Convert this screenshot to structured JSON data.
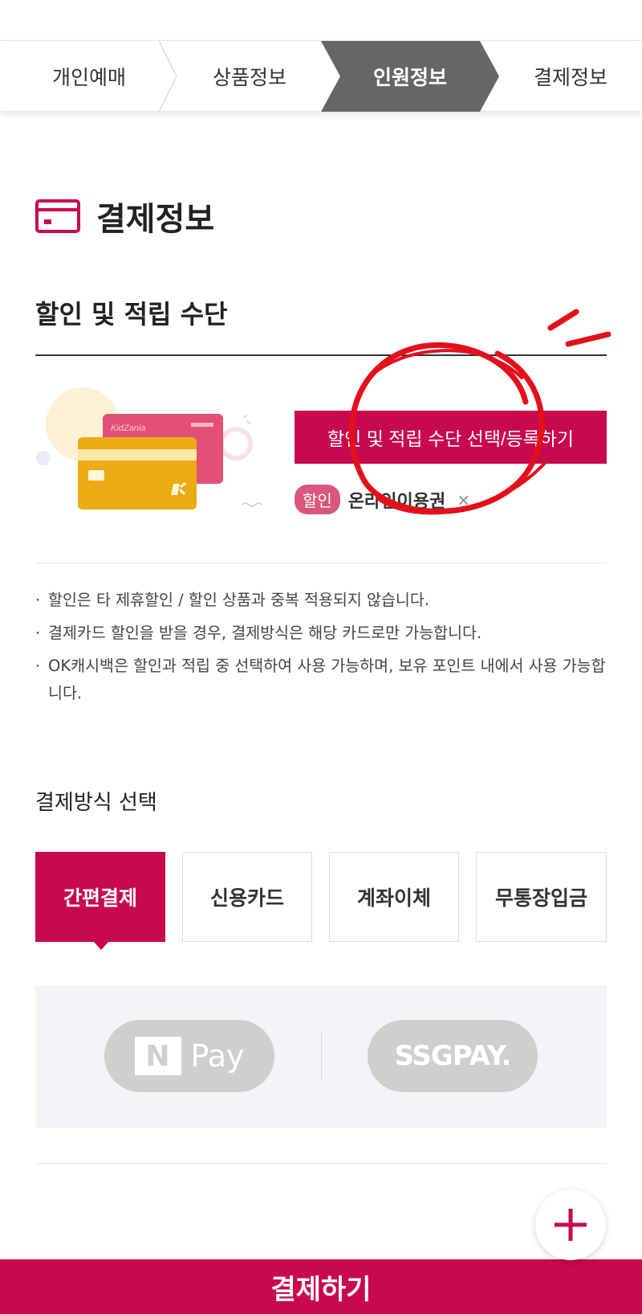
{
  "steps": [
    {
      "label": "개인예매",
      "active": false
    },
    {
      "label": "상품정보",
      "active": false
    },
    {
      "label": "인원정보",
      "active": true
    },
    {
      "label": "결제정보",
      "active": false
    }
  ],
  "section": {
    "title": "결제정보",
    "icon": "card-icon"
  },
  "discount": {
    "title": "할인 및 적립 수단",
    "button_label": "할인 및 적립 수단 선택/등록하기",
    "tag_badge": "할인",
    "tag_text": "온라인이용권",
    "tag_remove": "×",
    "illustration_brand": "KidZania"
  },
  "notes": [
    "할인은 타 제휴할인 / 할인 상품과 중복 적용되지 않습니다.",
    "결제카드 할인을 받을 경우, 결제방식은 해당 카드로만 가능합니다.",
    "OK캐시백은 할인과 적립 중 선택하여 사용 가능하며, 보유 포인트 내에서 사용 가능합니다."
  ],
  "payment": {
    "title": "결제방식 선택",
    "tabs": [
      {
        "label": "간편결제",
        "active": true
      },
      {
        "label": "신용카드",
        "active": false
      },
      {
        "label": "계좌이체",
        "active": false
      },
      {
        "label": "무통장입금",
        "active": false
      }
    ],
    "npay_n": "N",
    "npay_label": "Pay",
    "ssgpay_label": "SSGPAY."
  },
  "bottom": {
    "pay_button": "결제하기"
  },
  "colors": {
    "accent": "#c8094d",
    "active_step": "#666666",
    "tag": "#d9577f",
    "pill": "#cfcfcf"
  }
}
